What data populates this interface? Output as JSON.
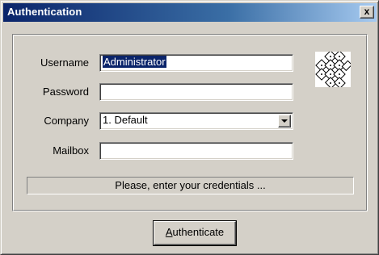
{
  "window": {
    "title": "Authentication",
    "close_label": "x"
  },
  "form": {
    "username": {
      "label": "Username",
      "value": "Administrator"
    },
    "password": {
      "label": "Password",
      "value": ""
    },
    "company": {
      "label": "Company",
      "value": "1. Default"
    },
    "mailbox": {
      "label": "Mailbox",
      "value": ""
    }
  },
  "status": {
    "message": "Please, enter your credentials ..."
  },
  "actions": {
    "authenticate_label": "Authenticate"
  },
  "icons": {
    "keyboard": "keyboard-icon",
    "dropdown": "chevron-down-icon"
  },
  "colors": {
    "titlebar_start": "#0a246a",
    "titlebar_end": "#a6caf0",
    "dialog_face": "#d4d0c8",
    "selection": "#0a246a"
  }
}
